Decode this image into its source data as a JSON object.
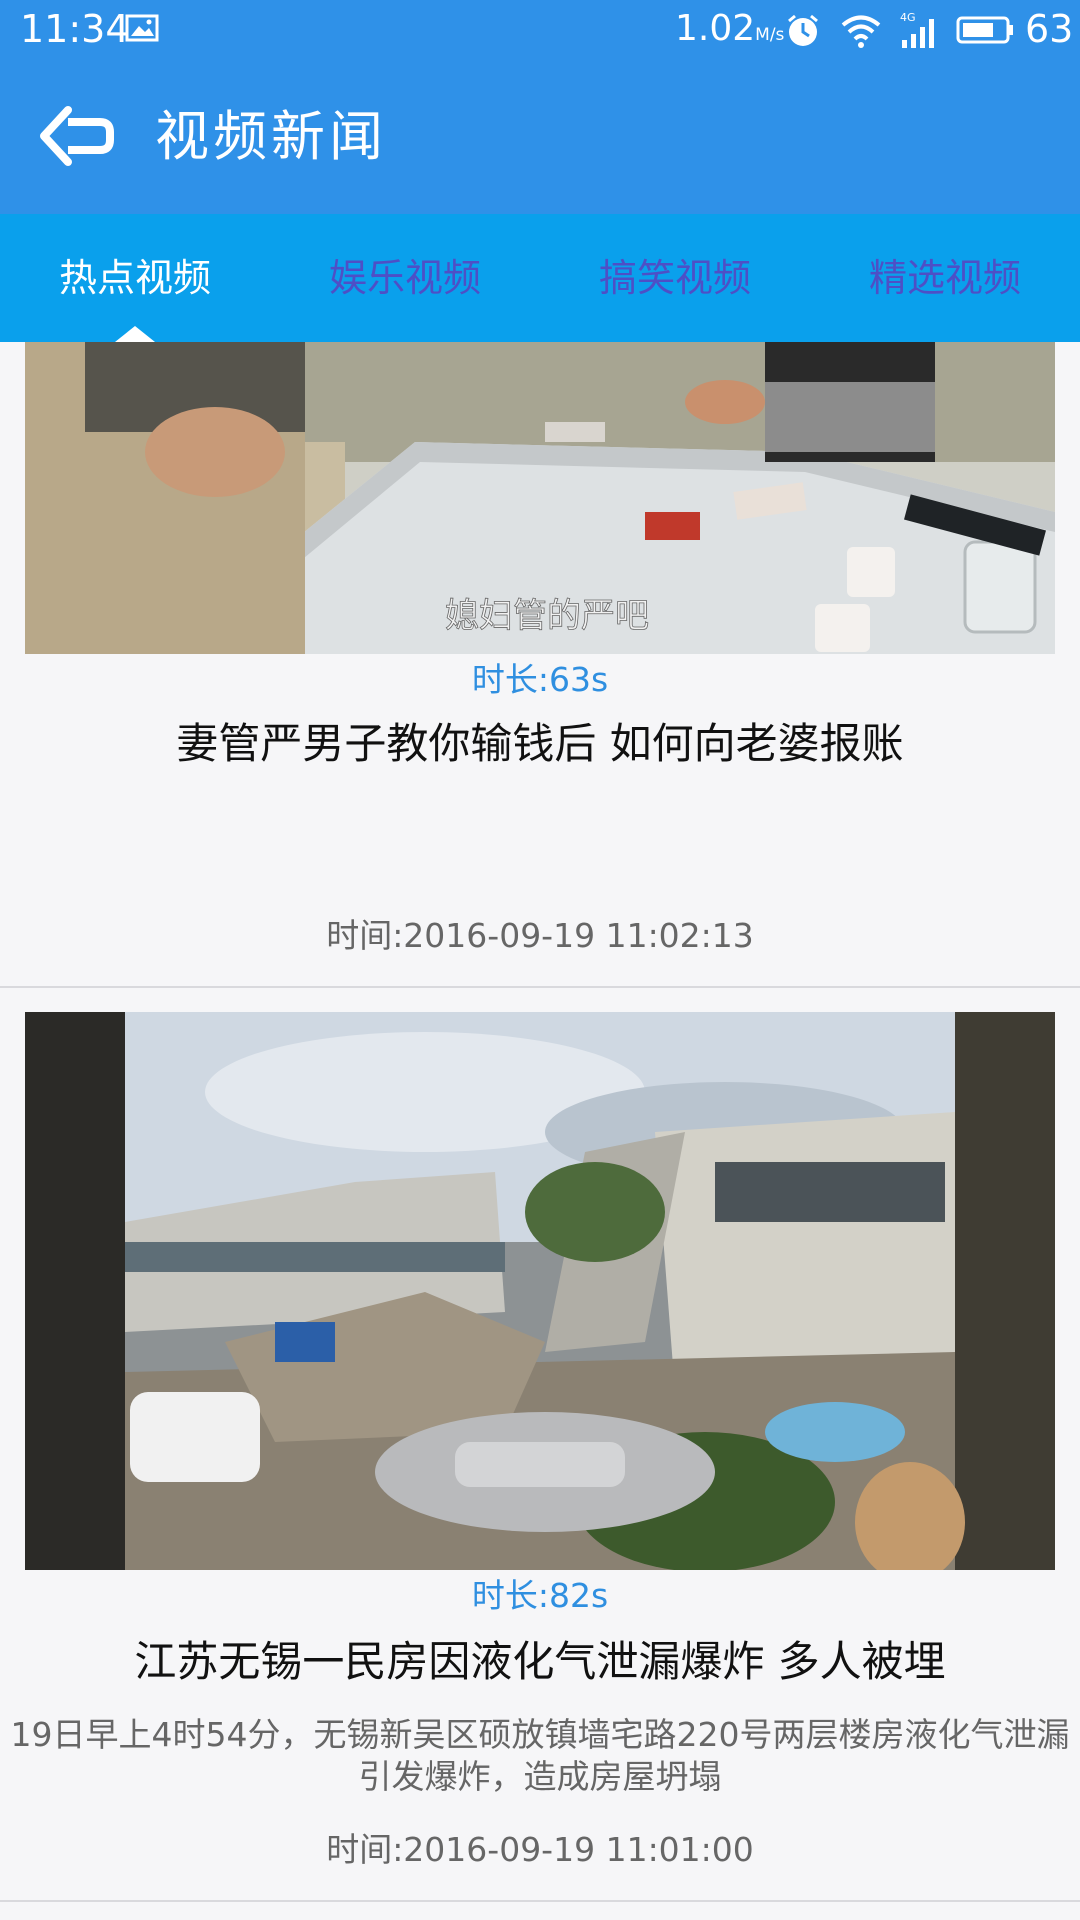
{
  "status_bar": {
    "time": "11:34",
    "speed": "1.02",
    "speed_unit": "M/s",
    "battery": "63"
  },
  "header": {
    "title": "视频新闻",
    "back_icon": "back-arrow-icon"
  },
  "tabs": [
    {
      "label": "热点视频",
      "active": true
    },
    {
      "label": "娱乐视频",
      "active": false
    },
    {
      "label": "搞笑视频",
      "active": false
    },
    {
      "label": "精选视频",
      "active": false
    }
  ],
  "news": [
    {
      "duration": "时长:63s",
      "title": "妻管严男子教你输钱后 如何向老婆报账",
      "summary": "",
      "time": "时间:2016-09-19 11:02:13",
      "thumb_caption": "媳妇管的严吧"
    },
    {
      "duration": "时长:82s",
      "title": "江苏无锡一民房因液化气泄漏爆炸 多人被埋",
      "summary": "19日早上4时54分，无锡新吴区硕放镇墙宅路220号两层楼房液化气泄漏引发爆炸，造成房屋坍塌",
      "time": "时间:2016-09-19 11:01:00"
    }
  ],
  "colors": {
    "primary": "#2f91e8",
    "tab_bar": "#0aa0ec",
    "tab_inactive": "#4e4fc6",
    "duration": "#2f8fe0"
  }
}
